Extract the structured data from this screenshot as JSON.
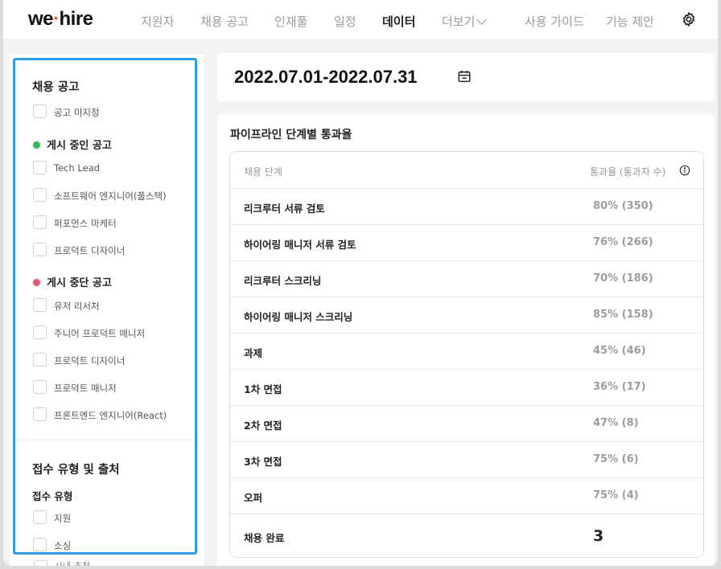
{
  "nav": {
    "logo_left": "we",
    "logo_dot": "·",
    "logo_right": "hire",
    "items": [
      "지원자",
      "채용 공고",
      "인재풀",
      "일정",
      "데이터",
      "더보기",
      "사용 가이드",
      "기능 제안"
    ],
    "active": "데이터"
  },
  "sidebar": {
    "section1_title": "채용 공고",
    "unassigned_label": "공고 미지정",
    "active_group": "게시 중인 공고",
    "active_items": [
      "Tech Lead",
      "소프트웨어 엔지니어(풀스택)",
      "퍼포먼스 마케터",
      "프로덕트 디자이너"
    ],
    "stopped_group": "게시 중단 공고",
    "stopped_items": [
      "유저 리서처",
      "주니어 프로덕트 매니저",
      "프로덕트 디자이너",
      "프로덕트 매니저",
      "프론트엔드 엔지니어(React)"
    ],
    "section2_title": "접수 유형 및 출처",
    "subsection_title": "접수 유형",
    "type_items": [
      "지원",
      "소싱"
    ],
    "cut_label": "사내 추천"
  },
  "date_range": "2022.07.01-2022.07.31",
  "pipeline": {
    "title": "파이프라인 단계별 통과율",
    "header_stage": "채용 단계",
    "header_rate": "통과율 (통과자 수)",
    "rows": [
      {
        "stage": "리크루터 서류 검토",
        "rate": "80% (350)"
      },
      {
        "stage": "하이어링 매니저 서류 검토",
        "rate": "76% (266)"
      },
      {
        "stage": "리크루터 스크리닝",
        "rate": "70% (186)"
      },
      {
        "stage": "하이어링 매니저 스크리닝",
        "rate": "85% (158)"
      },
      {
        "stage": "과제",
        "rate": "45% (46)"
      },
      {
        "stage": "1차 면접",
        "rate": "36% (17)"
      },
      {
        "stage": "2차 면접",
        "rate": "47% (8)"
      },
      {
        "stage": "3차 면접",
        "rate": "75% (6)"
      },
      {
        "stage": "오퍼",
        "rate": "75% (4)"
      },
      {
        "stage": "채용 완료",
        "rate": "3"
      }
    ]
  },
  "colors": {
    "accent_blue": "#2f9de6",
    "active_dot": "#3cb55a",
    "stopped_dot": "#e85a6b",
    "logo_dot": "#f05a28"
  }
}
